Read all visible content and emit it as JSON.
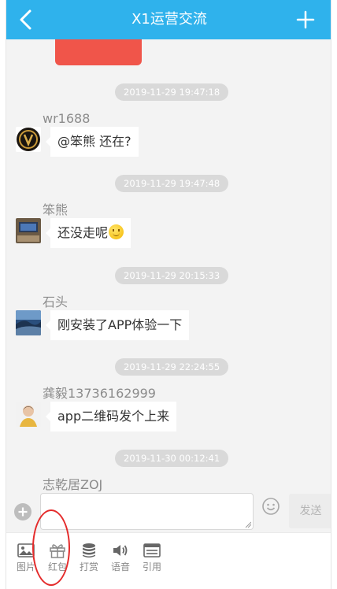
{
  "header": {
    "title": "X1运营交流",
    "back_icon": "chevron-left-icon",
    "add_icon": "plus-icon",
    "background": "#2fb2ec"
  },
  "messages": [
    {
      "timestamp": "2019-11-29 19:47:18",
      "sender": "wr1688",
      "text": "@笨熊 还在?"
    },
    {
      "timestamp": "2019-11-29 19:47:48",
      "sender": "笨熊",
      "text": "还没走呢"
    },
    {
      "timestamp": "2019-11-29 20:15:33",
      "sender": "石头",
      "text": "刚安装了APP体验一下"
    },
    {
      "timestamp": "2019-11-29 22:24:55",
      "sender": "龚毅13736162999",
      "text": "app二维码发个上来"
    },
    {
      "timestamp": "2019-11-30 00:12:41",
      "sender": "志乾居ZOJ"
    }
  ],
  "composer": {
    "send_label": "发送",
    "input_value": ""
  },
  "toolbar": {
    "images": "图片",
    "redpacket": "红包",
    "reward": "打赏",
    "voice": "语音",
    "quote": "引用"
  },
  "colors": {
    "accent": "#2fb2ec",
    "highlight_circle": "#e42b2b",
    "red_packet": "#f0554a"
  }
}
